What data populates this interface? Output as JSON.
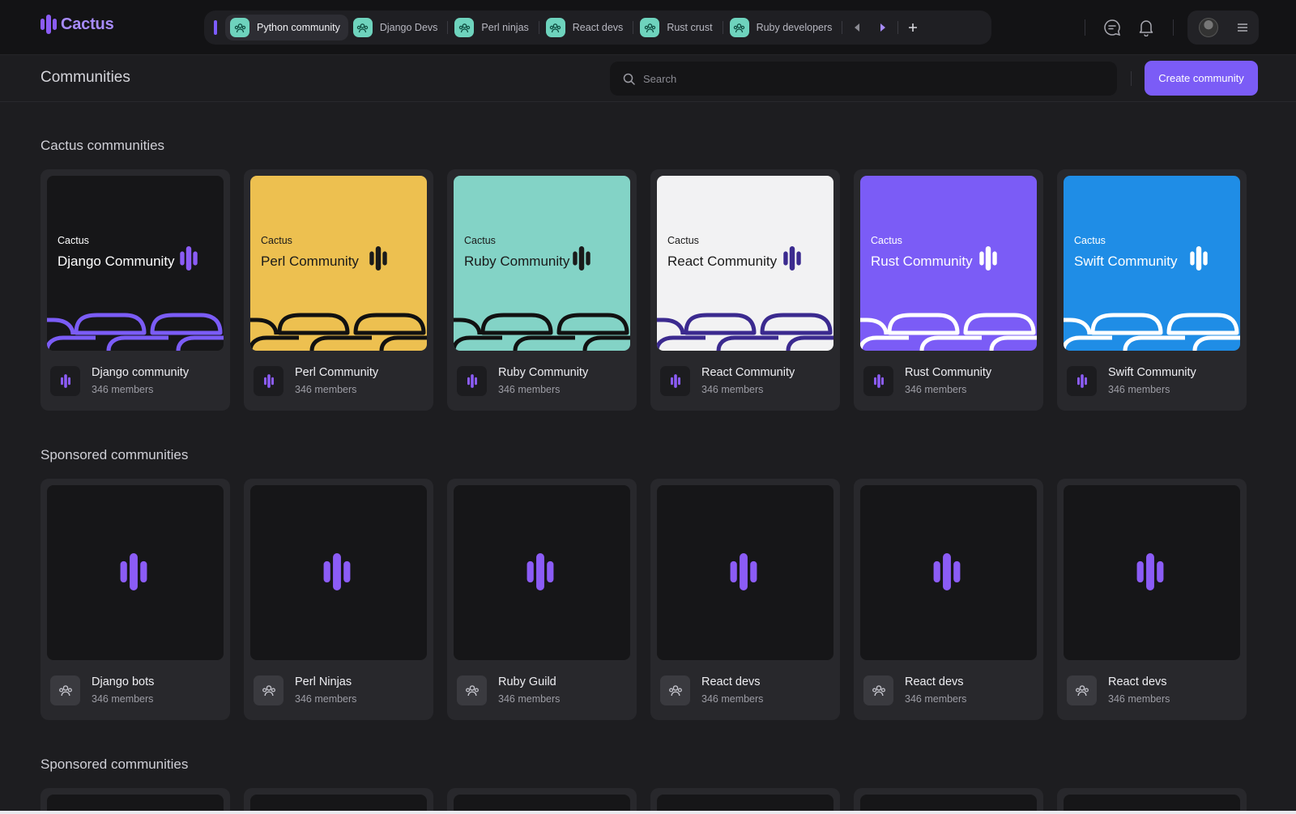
{
  "app": {
    "name": "Cactus"
  },
  "topbar": {
    "tabs": [
      {
        "label": "Python community",
        "active": true
      },
      {
        "label": "Django Devs",
        "active": false
      },
      {
        "label": "Perl ninjas",
        "active": false
      },
      {
        "label": "React devs",
        "active": false
      },
      {
        "label": "Rust crust",
        "active": false
      },
      {
        "label": "Ruby developers",
        "active": false
      }
    ],
    "icons": [
      "chevron-left-icon",
      "chevron-right-icon",
      "plus-icon",
      "chat-icon",
      "bell-icon",
      "avatar",
      "menu-icon"
    ]
  },
  "subheader": {
    "title": "Communities",
    "search_placeholder": "Search",
    "create_label": "Create community"
  },
  "sections": [
    {
      "title": "Cactus communities",
      "cards": [
        {
          "brand": "Cactus",
          "thumb_title": "Django Community",
          "name": "Django community",
          "members": "346 members",
          "bg": "#161618",
          "fg": "#ffffff",
          "logo": "#8b5cf6",
          "stroke": "#7b5cf6"
        },
        {
          "brand": "Cactus",
          "thumb_title": "Perl Community",
          "name": "Perl Community",
          "members": "346 members",
          "bg": "#edc050",
          "fg": "#1a1a1a",
          "logo": "#1a1a1a",
          "stroke": "#111111"
        },
        {
          "brand": "Cactus",
          "thumb_title": "Ruby Community",
          "name": "Ruby Community",
          "members": "346 members",
          "bg": "#83d3c6",
          "fg": "#1a1a1a",
          "logo": "#1a1a1a",
          "stroke": "#111111"
        },
        {
          "brand": "Cactus",
          "thumb_title": "React Community",
          "name": "React Community",
          "members": "346 members",
          "bg": "#f2f2f3",
          "fg": "#1a1a1a",
          "logo": "#3b2a8f",
          "stroke": "#3b2a8f"
        },
        {
          "brand": "Cactus",
          "thumb_title": "Rust Community",
          "name": "Rust Community",
          "members": "346 members",
          "bg": "#7b5cf6",
          "fg": "#ffffff",
          "logo": "#ffffff",
          "stroke": "#ffffff"
        },
        {
          "brand": "Cactus",
          "thumb_title": "Swift Community",
          "name": "Swift Community",
          "members": "346 members",
          "bg": "#1f8de6",
          "fg": "#ffffff",
          "logo": "#ffffff",
          "stroke": "#ffffff"
        }
      ]
    },
    {
      "title": "Sponsored communities",
      "cards": [
        {
          "name": "Django bots",
          "members": "346 members"
        },
        {
          "name": "Perl Ninjas",
          "members": "346 members"
        },
        {
          "name": "Ruby Guild",
          "members": "346 members"
        },
        {
          "name": "React devs",
          "members": "346 members"
        },
        {
          "name": "React devs",
          "members": "346 members"
        },
        {
          "name": "React devs",
          "members": "346 members"
        }
      ]
    },
    {
      "title": "Sponsored communities"
    }
  ],
  "colors": {
    "accent": "#7b5cf6",
    "tab_icon": "#6ed3bd"
  }
}
